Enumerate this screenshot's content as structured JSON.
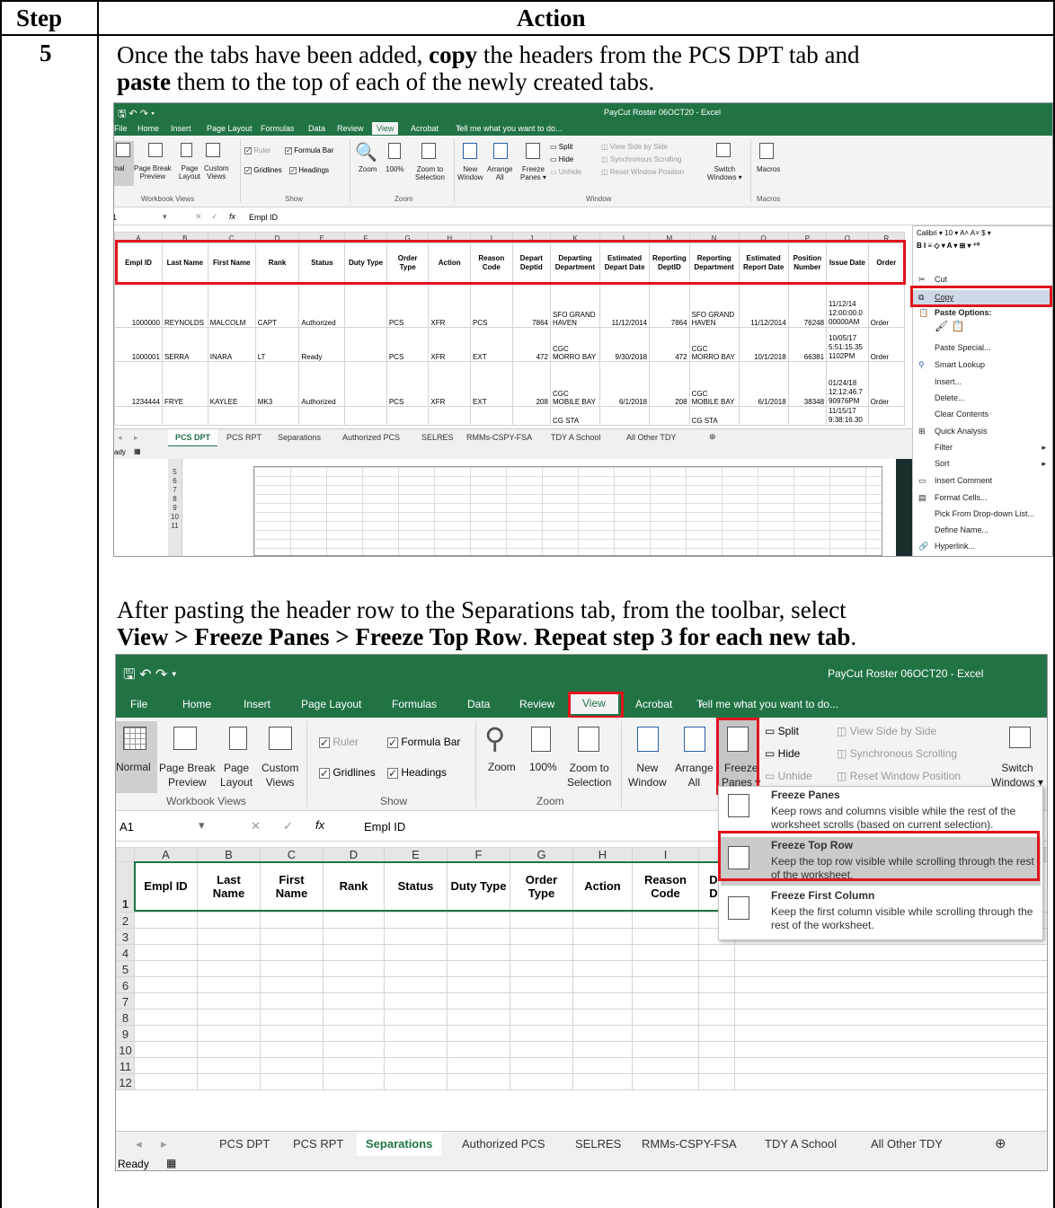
{
  "table": {
    "col_step": "Step",
    "col_action": "Action",
    "step_number": "5"
  },
  "para1": {
    "a": "Once the tabs have been added, ",
    "b": "copy",
    "c": " the headers from the PCS DPT tab and",
    "d": "paste",
    "e": " them to the top of each of the newly created tabs."
  },
  "para2": {
    "a": "After pasting the header row to the Separations tab, from the toolbar, select",
    "b": "View > Freeze Panes > Freeze Top Row",
    "c": ".   ",
    "d": "Repeat step 3 for each new tab",
    "e": "."
  },
  "excel": {
    "window_title": "PayCut Roster 06OCT20 - Excel",
    "menu": [
      "File",
      "Home",
      "Insert",
      "Page Layout",
      "Formulas",
      "Data",
      "Review",
      "View",
      "Acrobat"
    ],
    "tell_me": "Tell me what you want to do...",
    "ribbon": {
      "normal": "Normal",
      "page_break": "Page Break",
      "preview": "Preview",
      "page": "Page",
      "layout": "Layout",
      "custom": "Custom",
      "views": "Views",
      "workbook_views": "Workbook Views",
      "ruler": "Ruler",
      "formula_bar": "Formula Bar",
      "gridlines": "Gridlines",
      "headings": "Headings",
      "show": "Show",
      "zoom": "Zoom",
      "zoom100": "100%",
      "zoom_to": "Zoom to",
      "selection": "Selection",
      "zoom_group": "Zoom",
      "new": "New",
      "window": "Window",
      "arrange": "Arrange",
      "all": "All",
      "freeze": "Freeze",
      "panes": "Panes",
      "split": "Split",
      "hide": "Hide",
      "unhide": "Unhide",
      "side_by_side": "View Side by Side",
      "sync_scroll": "Synchronous Scrolling",
      "reset_pos": "Reset Window Position",
      "switch": "Switch",
      "windows": "Windows",
      "window_group": "Window",
      "macros": "Macros",
      "macros_group": "Macros"
    },
    "name_box": "A1",
    "fx": "fx",
    "formula_value": "Empl ID",
    "columns": [
      "A",
      "B",
      "C",
      "D",
      "E",
      "F",
      "G",
      "H",
      "I",
      "J",
      "K",
      "L",
      "M",
      "N",
      "O",
      "P",
      "Q",
      "R"
    ],
    "headers": [
      "Empl ID",
      "Last Name",
      "First Name",
      "Rank",
      "Status",
      "Duty Type",
      "Order Type",
      "Action",
      "Reason Code",
      "Depart Deptid",
      "Departing Department",
      "Estimated Depart Date",
      "Reporting DeptID",
      "Reporting Department",
      "Estimated Report Date",
      "Position Number",
      "Issue Date",
      "Order"
    ],
    "rows": [
      [
        "1000000",
        "REYNOLDS",
        "MALCOLM",
        "CAPT",
        "Authorized",
        "",
        "PCS",
        "XFR",
        "PCS",
        "7864",
        "SFO GRAND HAVEN",
        "11/12/2014",
        "7864",
        "SFO GRAND HAVEN",
        "11/12/2014",
        "76248",
        "11/12/14 12:00:00.0 00000AM",
        "Order"
      ],
      [
        "1000001",
        "SERRA",
        "INARA",
        "LT",
        "Ready",
        "",
        "PCS",
        "XFR",
        "EXT",
        "472",
        "CGC MORRO BAY",
        "9/30/2018",
        "472",
        "CGC MORRO BAY",
        "10/1/2018",
        "66381",
        "10/05/17 5:51:15.35 1102PM",
        "Order"
      ],
      [
        "1234444",
        "FRYE",
        "KAYLEE",
        "MK3",
        "Authorized",
        "",
        "PCS",
        "XFR",
        "EXT",
        "208",
        "CGC MOBILE BAY",
        "6/1/2018",
        "208",
        "CGC MOBILE BAY",
        "6/1/2018",
        "38348",
        "01/24/18 12:12:46.7 90976PM",
        "Order"
      ],
      [
        "",
        "",
        "",
        "",
        "",
        "",
        "",
        "",
        "",
        "",
        "CG STA",
        "",
        "",
        "CG STA",
        "",
        "",
        "11/15/17 9:38:16.30",
        ""
      ]
    ],
    "sheet_tabs": [
      "PCS DPT",
      "PCS RPT",
      "Separations",
      "Authorized PCS",
      "SELRES",
      "RMMs-CSPY-FSA",
      "TDY A School",
      "All Other TDY"
    ],
    "status_ready": "Ready",
    "ready_partial": "ady",
    "hidden_rows": [
      "5",
      "6",
      "7",
      "8",
      "9",
      "10",
      "11"
    ],
    "context_menu": {
      "font": "Calibri",
      "size": "10",
      "items": [
        "Cut",
        "Copy",
        "Paste Options:",
        "Paste Special...",
        "Smart Lookup",
        "Insert...",
        "Delete...",
        "Clear Contents",
        "Quick Analysis",
        "Filter",
        "Sort",
        "Insert Comment",
        "Format Cells...",
        "Pick From Drop-down List...",
        "Define Name...",
        "Hyperlink..."
      ]
    },
    "freeze_menu": {
      "fp_title": "Freeze Panes",
      "fp_desc": "Keep rows and columns visible while the rest of the worksheet scrolls (based on current selection).",
      "ftr_title": "Freeze Top Row",
      "ftr_desc": "Keep the top row visible while scrolling through the rest of the worksheet.",
      "ffc_title": "Freeze First Column",
      "ffc_desc": "Keep the first column visible while scrolling through the rest of the worksheet."
    },
    "row_numbers": [
      "1",
      "2",
      "3",
      "4",
      "5",
      "6",
      "7",
      "8",
      "9",
      "10",
      "11",
      "12"
    ]
  }
}
